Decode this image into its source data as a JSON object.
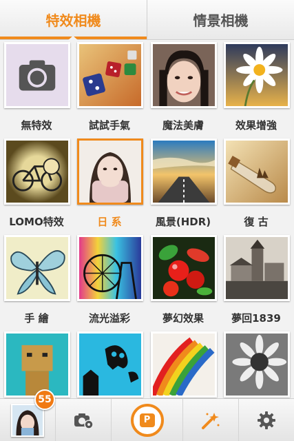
{
  "tabs": [
    {
      "label": "特效相機",
      "active": true
    },
    {
      "label": "情景相機",
      "active": false
    }
  ],
  "effects": [
    {
      "label": "無特效",
      "selected": false
    },
    {
      "label": "試試手氣",
      "selected": false
    },
    {
      "label": "魔法美膚",
      "selected": false
    },
    {
      "label": "效果增強",
      "selected": false
    },
    {
      "label": "LOMO特效",
      "selected": false
    },
    {
      "label": "日 系",
      "selected": true
    },
    {
      "label": "風景(HDR)",
      "selected": false
    },
    {
      "label": "復 古",
      "selected": false
    },
    {
      "label": "手 繪",
      "selected": false
    },
    {
      "label": "流光溢彩",
      "selected": false
    },
    {
      "label": "夢幻效果",
      "selected": false
    },
    {
      "label": "夢回1839",
      "selected": false
    },
    {
      "label": "",
      "selected": false
    },
    {
      "label": "",
      "selected": false
    },
    {
      "label": "",
      "selected": false
    },
    {
      "label": "",
      "selected": false
    }
  ],
  "toolbar": {
    "badge_count": "55",
    "shutter_glyph": "P",
    "icons": [
      "avatar",
      "camera-settings-icon",
      "shutter-icon",
      "magic-wand-icon",
      "gear-icon"
    ]
  },
  "colors": {
    "accent": "#f08a1c",
    "badge": "#f07a14"
  }
}
